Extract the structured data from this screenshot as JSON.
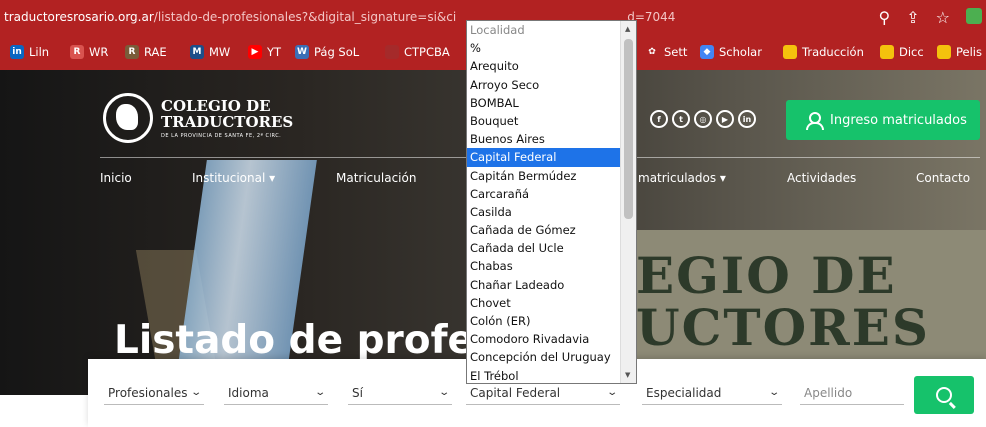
{
  "browser": {
    "url_domain": "traductoresrosario.org.ar",
    "url_path": "/listado-de-profesionales?&digital_signature=si&ci",
    "url_tail": "d=7044",
    "bookmarks": [
      {
        "label": "Liln",
        "color": "#0a66c2",
        "glyph": "in"
      },
      {
        "label": "WR",
        "color": "#d9534f",
        "glyph": "R"
      },
      {
        "label": "RAE",
        "color": "#7a5c3a",
        "glyph": "R"
      },
      {
        "label": "MW",
        "color": "#1d4e89",
        "glyph": "M"
      },
      {
        "label": "YT",
        "color": "#ff0000",
        "glyph": "▶"
      },
      {
        "label": "Pág SoL",
        "color": "#3b6fb6",
        "glyph": "W"
      },
      {
        "label": "CTPCBA",
        "color": "#a52a2a",
        "glyph": ""
      },
      {
        "label": "Sett",
        "color": "#b22222",
        "glyph": "✿"
      },
      {
        "label": "Scholar",
        "color": "#4285f4",
        "glyph": "◆"
      },
      {
        "label": "Traducción",
        "color": "#f4c20d",
        "glyph": ""
      },
      {
        "label": "Dicc",
        "color": "#f4c20d",
        "glyph": ""
      },
      {
        "label": "Pelis",
        "color": "#f4c20d",
        "glyph": ""
      }
    ]
  },
  "site": {
    "logo_line1": "COLEGIO DE",
    "logo_line2": "TRADUCTORES",
    "logo_sub": "DE LA PROVINCIA DE SANTA FE, 2ª CIRC.",
    "login_label": "Ingreso matriculados",
    "nav": [
      "Inicio",
      "Institucional ▾",
      "Matriculación",
      "matriculados ▾",
      "Actividades",
      "Contacto"
    ],
    "hero_title": "Listado de profesio",
    "wall_text_1": "EGIO DE",
    "wall_text_2": "UCTORES"
  },
  "filters": {
    "profesionales": "Profesionales",
    "idioma": "Idioma",
    "firma": "Sí",
    "localidad": "Capital Federal",
    "especialidad": "Especialidad",
    "apellido_placeholder": "Apellido"
  },
  "dropdown": {
    "options": [
      "Localidad",
      "%",
      "Arequito",
      "Arroyo Seco",
      "BOMBAL",
      "Bouquet",
      "Buenos Aires",
      "Capital Federal",
      "Capitán Bermúdez",
      "Carcarañá",
      "Casilda",
      "Cañada de Gómez",
      "Cañada del Ucle",
      "Chabas",
      "Chañar Ladeado",
      "Chovet",
      "Colón (ER)",
      "Comodoro Rivadavia",
      "Concepción del Uruguay",
      "El Trébol"
    ],
    "selected_index": 7
  }
}
